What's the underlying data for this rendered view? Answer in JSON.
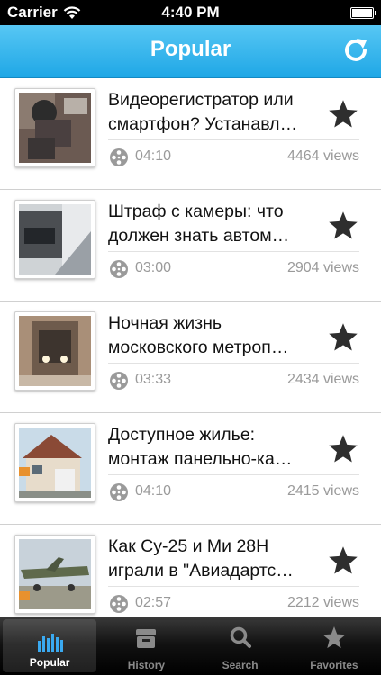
{
  "status": {
    "carrier": "Carrier",
    "time": "4:40 PM"
  },
  "nav": {
    "title": "Popular"
  },
  "videos": [
    {
      "title": "Видеорегистратор или смартфон? Устанавл…",
      "duration": "04:10",
      "views": "4464 views"
    },
    {
      "title": "Штраф с камеры: что должен знать автом…",
      "duration": "03:00",
      "views": "2904 views"
    },
    {
      "title": "Ночная жизнь московского метроп…",
      "duration": "03:33",
      "views": "2434 views"
    },
    {
      "title": "Доступное жилье: монтаж панельно-ка…",
      "duration": "04:10",
      "views": "2415 views"
    },
    {
      "title": "Как Су-25 и Ми 28Н играли в \"Авиадартс…",
      "duration": "02:57",
      "views": "2212 views"
    }
  ],
  "tabs": [
    {
      "label": "Popular",
      "icon": "bar-chart-icon",
      "active": true
    },
    {
      "label": "History",
      "icon": "history-box-icon",
      "active": false
    },
    {
      "label": "Search",
      "icon": "search-icon",
      "active": false
    },
    {
      "label": "Favorites",
      "icon": "star-icon",
      "active": false
    }
  ],
  "colors": {
    "navbar": "#1fa7e6",
    "muted_text": "#9a9a9a",
    "tab_active_icon": "#3aa9f0"
  }
}
